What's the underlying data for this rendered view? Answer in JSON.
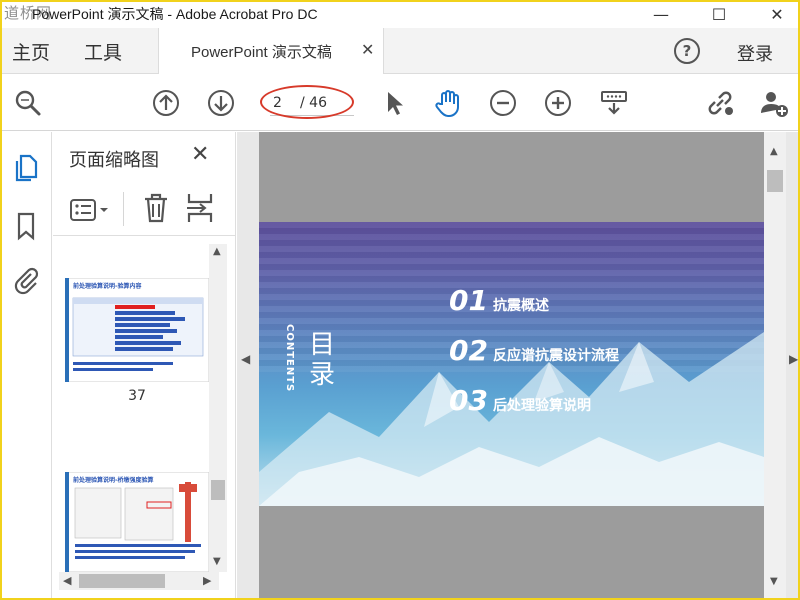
{
  "window": {
    "logo_text": "道桥网",
    "title": "PowerPoint 演示文稿 - Adobe Acrobat Pro DC",
    "minimize_glyph": "—",
    "maximize_glyph": "☐",
    "close_glyph": "✕"
  },
  "tabs": {
    "home": "主页",
    "tools": "工具",
    "document": "PowerPoint 演示文稿",
    "document_close": "✕",
    "help": "?",
    "login": "登录"
  },
  "toolbar": {
    "current_page": "2",
    "total_pages": "/ 46",
    "icons": [
      "search-icon",
      "page-up-icon",
      "page-down-icon",
      "select-arrow-icon",
      "hand-tool-icon",
      "zoom-out-icon",
      "zoom-in-icon",
      "reading-mode-icon",
      "share-link-icon",
      "add-user-icon"
    ]
  },
  "sidebar": {
    "panel_title": "页面缩略图",
    "panel_close": "✕",
    "thumbnails": [
      {
        "page_label": "37",
        "heading": "前处理验算说明-验算内容"
      },
      {
        "heading": "前处理验算说明-桥墩强度验算"
      }
    ]
  },
  "slide": {
    "contents_label": "CONTENTS",
    "mulu": "目录",
    "items": [
      {
        "num": "01",
        "text": "抗震概述"
      },
      {
        "num": "02",
        "text": "反应谱抗震设计流程"
      },
      {
        "num": "03",
        "text": "后处理验算说明"
      }
    ]
  },
  "colors": {
    "accent_blue": "#1a73c7",
    "annotation_red": "#d73a2a",
    "frame_yellow": "#f1d21c"
  }
}
